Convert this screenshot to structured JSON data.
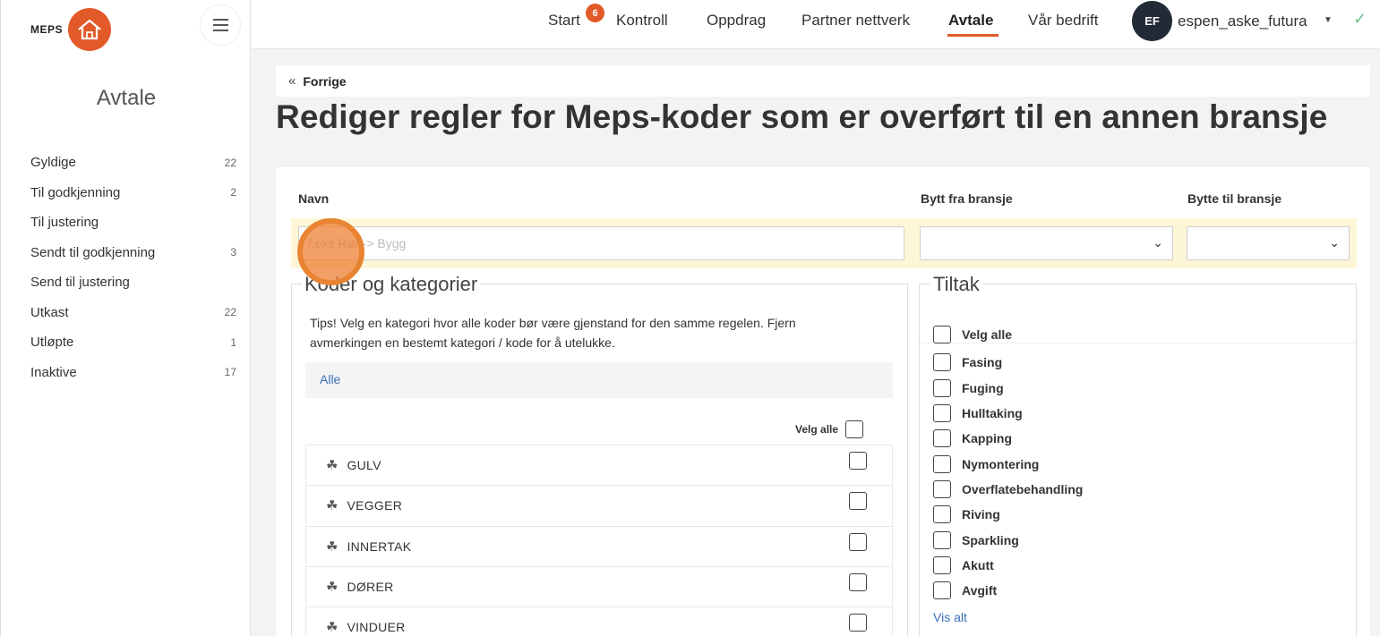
{
  "brand": {
    "name": "MEPS"
  },
  "sidebar": {
    "title": "Avtale",
    "items": [
      {
        "label": "Gyldige",
        "count": "22"
      },
      {
        "label": "Til godkjenning",
        "count": "2"
      },
      {
        "label": "Til justering",
        "count": ""
      },
      {
        "label": "Sendt til godkjenning",
        "count": "3"
      },
      {
        "label": "Send til justering",
        "count": ""
      },
      {
        "label": "Utkast",
        "count": "22"
      },
      {
        "label": "Utløpte",
        "count": "1"
      },
      {
        "label": "Inaktive",
        "count": "17"
      }
    ]
  },
  "nav": {
    "items": [
      "Start",
      "Kontroll",
      "Oppdrag",
      "Partner nettverk",
      "Avtale",
      "Vår bedrift"
    ],
    "active": "Avtale",
    "start_badge": "6",
    "user": {
      "initials": "EF",
      "name": "espen_aske_futura"
    }
  },
  "page": {
    "back_label": "Forrige",
    "title": "Rediger regler for Meps-koder som er overført til en annen bransje"
  },
  "form": {
    "name_label": "Navn",
    "from_label": "Bytt fra bransje",
    "to_label": "Bytte til bransje",
    "name_placeholder": "f.eks Rør -> Bygg",
    "from_value": "",
    "to_value": ""
  },
  "codes": {
    "legend": "Koder og kategorier",
    "tips": "Tips! Velg en kategori hvor alle koder bør være gjenstand for den samme regelen. Fjern avmerkingen en bestemt kategori / kode for å utelukke.",
    "all_link": "Alle",
    "select_all": "Velg alle",
    "categories": [
      "GULV",
      "VEGGER",
      "INNERTAK",
      "DØRER",
      "VINDUER"
    ]
  },
  "tiltak": {
    "legend": "Tiltak",
    "select_all": "Velg alle",
    "items": [
      "Fasing",
      "Fuging",
      "Hulltaking",
      "Kapping",
      "Nymontering",
      "Overflatebehandling",
      "Riving",
      "Sparkling",
      "Akutt",
      "Avgift"
    ],
    "show_all": "Vis alt"
  },
  "colors": {
    "accent": "#e35a2a",
    "link": "#3a6fb5",
    "highlight": "#fdf6d7",
    "confirm": "#6dbf87"
  }
}
